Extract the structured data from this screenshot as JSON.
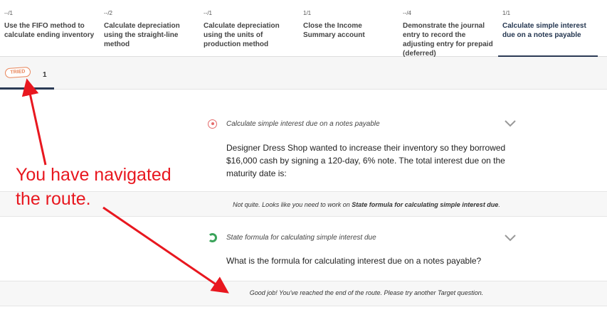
{
  "tabs": [
    {
      "count": "--/1",
      "title": "Use the FIFO method to calculate ending inventory",
      "active": false
    },
    {
      "count": "--/2",
      "title": "Calculate depreciation using the straight-line method",
      "active": false
    },
    {
      "count": "--/1",
      "title": "Calculate depreciation using the units of production method",
      "active": false
    },
    {
      "count": "1/1",
      "title": "Close the Income Summary account",
      "active": false
    },
    {
      "count": "--/4",
      "title": "Demonstrate the journal entry to record the adjusting entry for prepaid (deferred)",
      "active": false
    },
    {
      "count": "1/1",
      "title": "Calculate simple interest due on a notes payable",
      "active": true
    }
  ],
  "attempt": {
    "badge": "TRIED",
    "number": "1"
  },
  "question1": {
    "title": "Calculate simple interest due on a notes payable",
    "text": "Designer Dress Shop wanted to increase their inventory so they borrowed $16,000 cash by signing a 120-day, 6% note.  The total interest due on the maturity date is:",
    "icon": "target-wrong-icon"
  },
  "feedback1": {
    "prefix": "Not quite. Looks like you need to work on ",
    "emph": "State formula for calculating simple interest due",
    "suffix": "."
  },
  "question2": {
    "title": "State formula for calculating simple interest due",
    "text": "What is the formula for calculating interest due on a notes payable?",
    "icon": "check-correct-icon"
  },
  "feedback2": {
    "text": "Good job! You've reached the end of the route. Please try another Target question."
  },
  "annotation": {
    "line1": "You have navigated",
    "line2": "the route.",
    "color": "#e8171f"
  },
  "colors": {
    "accent": "#2b3a55",
    "tried": "#e8855a",
    "wrong": "#e46b6b",
    "correct": "#3aa35a"
  }
}
